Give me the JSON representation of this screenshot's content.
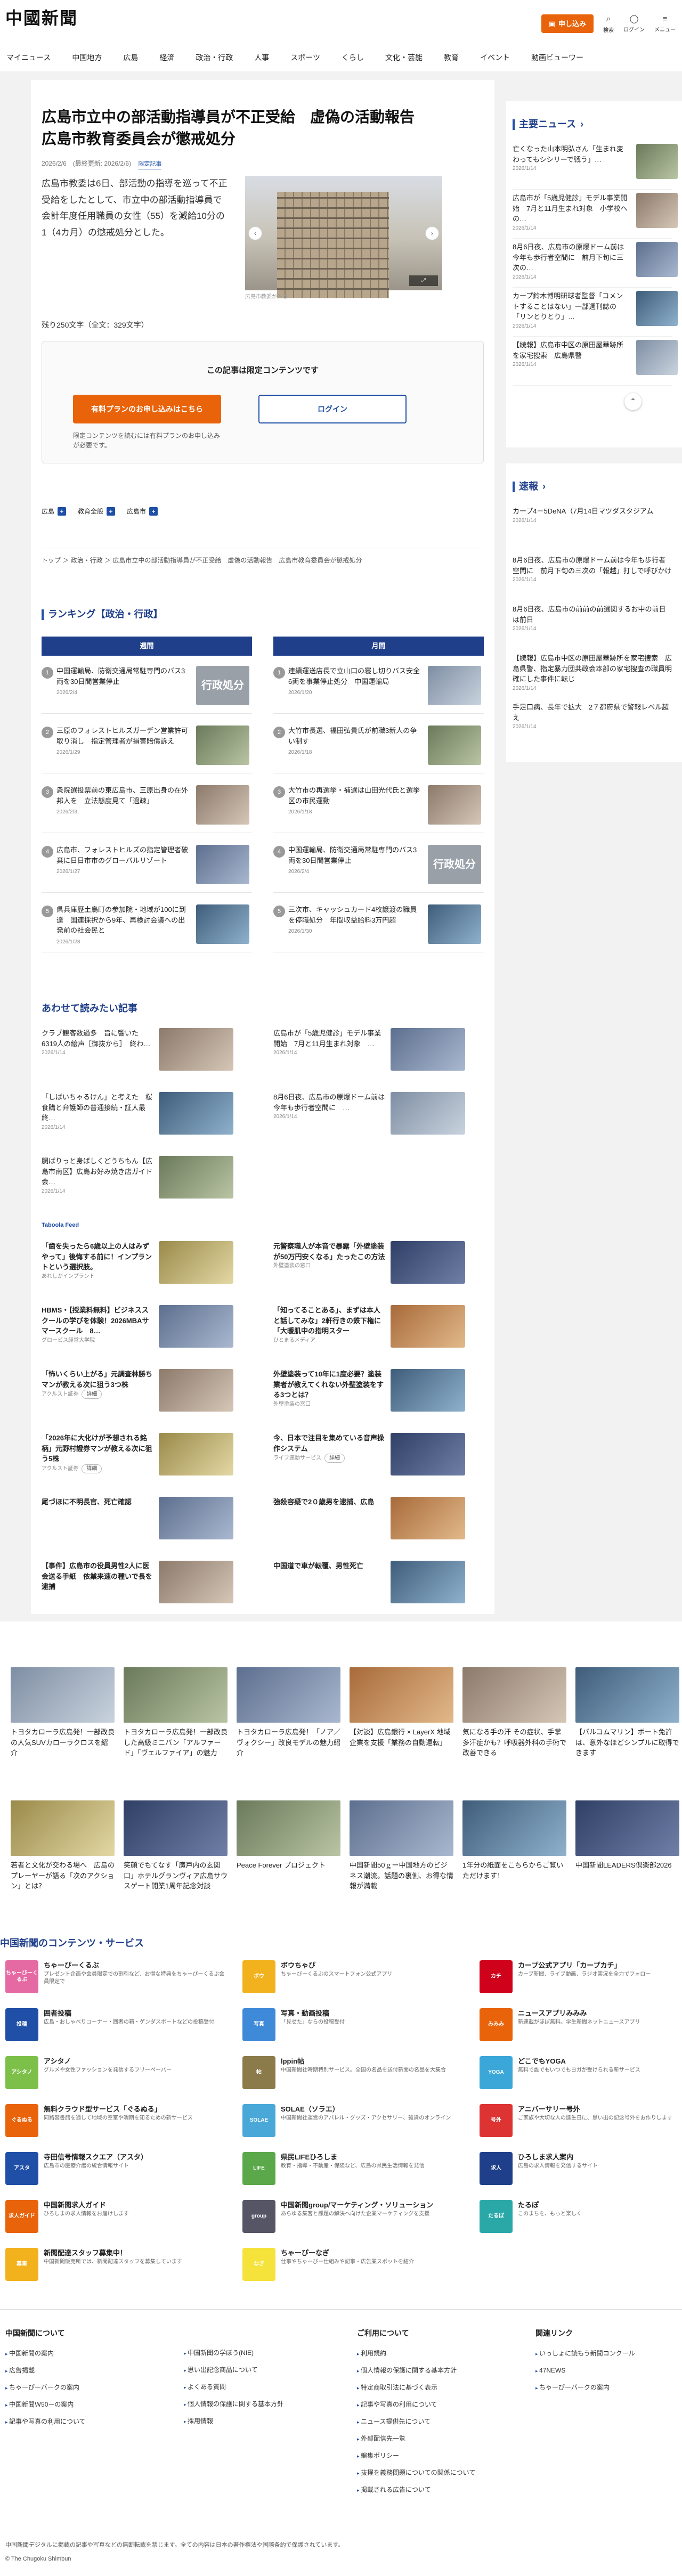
{
  "header": {
    "logo": "中國新聞",
    "apply_btn": "申し込み",
    "search": "検索",
    "login": "ログイン",
    "menu": "メニュー"
  },
  "gnav": [
    "マイニュース",
    "中国地方",
    "広島",
    "経済",
    "政治・行政",
    "人事",
    "スポーツ",
    "くらし",
    "文化・芸能",
    "教育",
    "イベント",
    "動画ビューワー"
  ],
  "article": {
    "title": "広島市立中の部活動指導員が不正受給　虚偽の活動報告　広島市教育委員会が懲戒処分",
    "dates": "2026/2/6　(最終更新: 2026/2/6)",
    "badge": "限定記事",
    "lead": "広島市教委は6日、部活動の指導を巡って不正受給をしたとして、市立中の部活動指導員で会計年度任用職員の女性（55）を減給10分の1（4カ月）の懲戒処分とした。",
    "photo_caption": "広島市教委が入る",
    "char_count": "残り250文字（全文：329文字）",
    "locked_title": "この記事は限定コンテンツです",
    "paid_btn": "有料プランのお申し込みはこちら",
    "login_btn": "ログイン",
    "locked_note": "限定コンテンツを読むには有料プランのお申し込みが必要です。",
    "tags": [
      "広島",
      "教育全般",
      "広島市"
    ],
    "breadcrumb": "トップ ＞ 政治・行政 ＞ 広島市立中の部活動指導員が不正受給　虚偽の活動報告　広島市教育委員会が懲戒処分"
  },
  "ranking": {
    "title": "ランキング【政治・行政】",
    "weekly": "週間",
    "monthly": "月間",
    "left": [
      {
        "n": "1",
        "t": "中国運輸局、防衛交通局常駐専門のバス3両を30日間営業停止",
        "d": "2026/2/4",
        "img": "行政処分"
      },
      {
        "n": "2",
        "t": "三原のフォレストヒルズガーデン営業許可取り消し　指定管理者が損害賠償訴え",
        "d": "2026/1/29",
        "img": ""
      },
      {
        "n": "3",
        "t": "衆院選投票前の東広島市、三原出身の在外邦人を　立法態度見て「過疎」",
        "d": "2026/2/3",
        "img": ""
      },
      {
        "n": "4",
        "t": "広島市、フォレストヒルズの指定管理者破棄に日日市市のグローバルリゾート",
        "d": "2026/1/27",
        "img": ""
      },
      {
        "n": "5",
        "t": "県兵庫歴土鳥町の参加院・地域が100に到達　国連採択から9年、再検討会議への出発前の社会民と",
        "d": "2026/1/28",
        "img": ""
      }
    ],
    "right": [
      {
        "n": "1",
        "t": "連續運送店長で立山口の寝し切りバス安全6両を事業停止処分　中国運輸局",
        "d": "2026/1/20",
        "img": ""
      },
      {
        "n": "2",
        "t": "大竹市長選、福田弘貴氏が前職3新人の争い制す",
        "d": "2026/1/18",
        "img": ""
      },
      {
        "n": "3",
        "t": "大竹市の再選挙・補選は山田光代氏と選挙区の市民運動",
        "d": "2026/1/18",
        "img": ""
      },
      {
        "n": "4",
        "t": "中国運輸局、防衛交通局常駐専門のバス3両を30日間営業停止",
        "d": "2026/2/4",
        "img": "行政処分"
      },
      {
        "n": "5",
        "t": "三次市、キャッシュカード4枚譲渡の職員を停職処分　年間収益給料3万円超",
        "d": "2026/1/30",
        "img": ""
      }
    ]
  },
  "related": {
    "title": "あわせて読みたい記事",
    "items": [
      {
        "t": "クラブ観客数過多　旨に響いた6319人の絵声［御抜から］　終わ…",
        "d": "2026/1/14"
      },
      {
        "t": "広島市が「5歳児健診」モデル事業開始　7月と11月生まれ対象　…",
        "d": "2026/1/14"
      },
      {
        "t": "「しばいちゃるけん」と考えた　桜食購と弁護師の普通接続・証人最終…",
        "d": "2026/1/14"
      },
      {
        "t": "8月6日夜、広島市の原爆ドーム前は今年も歩行者空間に　…",
        "d": "2026/1/14"
      },
      {
        "t": "胴ばりっと身ばしくどうちもん【広島市南区】広島お好み焼き店ガイド　会…",
        "d": "2026/1/14"
      }
    ]
  },
  "ads": {
    "label": "Taboola Feed",
    "items": [
      {
        "t": "「歯を失ったら6歳以上の人はみずやって」後悔する前に！インプラントという選択肢。",
        "s": "あれしかインプラント",
        "btn": ""
      },
      {
        "t": "元警察職人が本音で暴露「外壁塗装が50万円安くなる」たったこの方法",
        "s": "外壁塗装の窓口",
        "btn": ""
      },
      {
        "t": "HBMS・【授業料無料】ビジネススクールの学びを体験！2026MBAサマースクール　8…",
        "s": "グロービス経営大学院",
        "btn": ""
      },
      {
        "t": "「知ってることある」、まずは本人と話してみな」2軒行きの鉄下権に「大暖肌中の指明スター",
        "s": "ひとまるメディア",
        "btn": ""
      },
      {
        "t": "「怖いくらい上がる」元調査林勝ちマンが教える次に狙う3つ株",
        "s": "アクルスト証券",
        "btn": "詳細"
      },
      {
        "t": "外壁塗装って10年に1度必要？塗装業者が教えてくれない外壁塗装をする3つとは？",
        "s": "外壁塗装の窓口",
        "btn": ""
      },
      {
        "t": "「2026年に大化けが予想される銘柄」元野村證券マンが教える次に狙う5株",
        "s": "アクルスト証券",
        "btn": "詳細"
      },
      {
        "t": "今、日本で注目を集めている音声操作システム",
        "s": "ライフ連動サービス",
        "btn": "詳細"
      },
      {
        "t": "尾づほに不明長官、死亡確認",
        "s": "",
        "btn": ""
      },
      {
        "t": "強殺容疑で2０歳男を逮捕、広島",
        "s": "",
        "btn": ""
      },
      {
        "t": "【事件】広島市の役員男性2人に医会送る手紙　依業来速の種いで長を逮捕",
        "s": "",
        "btn": ""
      },
      {
        "t": "中国道で車が転覆、男性死亡",
        "s": "",
        "btn": ""
      }
    ]
  },
  "sidebar": {
    "main_news_title": "主要ニュース",
    "main_news": [
      {
        "t": "亡くなった山本明弘さん「生まれ変わってもシシリーで戦う」…",
        "d": "2026/1/14"
      },
      {
        "t": "広島市が「5歳児健診」モデル事業開始　7月と11月生まれ対象　小学校への…",
        "d": "2026/1/14"
      },
      {
        "t": "8月6日夜、広島市の原爆ドーム前は今年も歩行者空間に　前月下旬に三次の…",
        "d": "2026/1/14"
      },
      {
        "t": "カープ鈴木博明研球者監督「コメントすることはない」一部週刊誌の「リンとりとり」…",
        "d": "2026/1/14"
      },
      {
        "t": "【続報】広島市中区の原田屋華跡所を家宅捜索　広島県警",
        "d": "2026/1/14"
      }
    ],
    "sokuho_title": "速報",
    "sokuho": [
      {
        "t": "カープ4－5DeNA（7月14日マツダスタジアム",
        "d": "2026/1/14"
      },
      {
        "t": "8月6日夜、広島市の原爆ドーム前は今年も歩行者空間に　前月下旬の三次の「報越」打しで呼びかけ",
        "d": "2026/1/14"
      },
      {
        "t": "8月6日夜、広島市の前前の前選関するお中の前日は前日",
        "d": "2026/1/14"
      },
      {
        "t": "【続報】広島市中区の原田屋華跡所を家宅捜索　広島県警、指定暴力団共政会本部の家宅捜査の職員明確にした事件に転じ",
        "d": "2026/1/14"
      },
      {
        "t": "手足口病、長年で拡大　2７都府県で警報レベル超え",
        "d": "2026/1/14"
      }
    ]
  },
  "tiles": [
    {
      "t": "トヨタカローラ広島発！一部改良の人気SUVカローラクロスを紹介"
    },
    {
      "t": "トヨタカローラ広島発！一部改良した高級ミニバン「アルファード」「ヴェルファイア」の魅力"
    },
    {
      "t": "トヨタカローラ広島発！「ノア／ヴォクシー」改良モデルの魅力紹介"
    },
    {
      "t": "【対談】広島銀行 × LayerX 地域企業を支援「業務の自動運転」"
    },
    {
      "t": "気になる手の汗 その症状、手掌多汗症かも？呼吸器外科の手術で改善できる"
    },
    {
      "t": "【バルコムマリン】ボート免許は、意外なほどシンプルに取得できます"
    },
    {
      "t": "若者と文化が交わる場へ　広島のプレーヤーが語る「次のアクション」とは？"
    },
    {
      "t": "笑顔でもてなす「廣戸内の玄関口」ホテルグランヴィア広島サウスゲート開業1周年記念対談"
    },
    {
      "t": "Peace Forever プロジェクト"
    },
    {
      "t": "中国新聞50ｇー中国地方のビジネス潮流。話題の裏側、お得な情報が満載"
    },
    {
      "t": "1年分の紙面をこちらからご覧いただけます！"
    },
    {
      "t": "中国新聞LEADERS倶楽部2026"
    }
  ],
  "services": {
    "title": "中国新聞のコンテンツ・サービス",
    "items": [
      {
        "n": "ちゃーぴーくるぶ",
        "d": "プレゼント企画や会員限定での割引など、お得な特典をちゃーぴーくるぶ会員限定で",
        "c": "#e56aa4",
        "l": "ちゃーぴーくるぶ"
      },
      {
        "n": "ボウちゃぴ",
        "d": "ちゃーぴーくるぶのスマートフォン公式アプリ",
        "c": "#f2b21d",
        "l": "ボウ"
      },
      {
        "n": "カープ公式アプリ「カープカチ」",
        "d": "カープ新聞、ライブ動画、ラジオ実況を全力でフォロー",
        "c": "#d0021b",
        "l": "カチ"
      },
      {
        "n": "囲者投稿",
        "d": "広島・おしゃべりコーナー・囲者の箱・ゲンダスポートなどの投稿受付",
        "c": "#1f4fa6",
        "l": "投稿"
      },
      {
        "n": "写真・動画投稿",
        "d": "「見せた」ならの投稿受付",
        "c": "#3f8ad8",
        "l": "写真"
      },
      {
        "n": "ニュースアプリみみみ",
        "d": "新連載がほぼ無料。学生新聞ネットニュースアプリ",
        "c": "#e8630a",
        "l": "みみみ"
      },
      {
        "n": "アシタノ",
        "d": "グルメや女性ファッションを発信するフリーペーパー",
        "c": "#7cc04a",
        "l": "アシタノ"
      },
      {
        "n": "lppin帖",
        "d": "中国新聞社時期特別サービス。全国の名品を送付新聞の名品を大集合",
        "c": "#8b7a4a",
        "l": "帖"
      },
      {
        "n": "どこでもYOGA",
        "d": "無料で誰でもいつでもヨガが受けられる新サービス",
        "c": "#3aa7d8",
        "l": "YOGA"
      },
      {
        "n": "無料クラウド型サービス「ぐるぬる」",
        "d": "同路図書館を通して地域の空室や暇期を知るための新サービス",
        "c": "#e8630a",
        "l": "ぐるぬる"
      },
      {
        "n": "SOLAE（ソラエ）",
        "d": "中国新聞社運営のアパレル・グッズ・アクセサリー、雑貨のオンライン",
        "c": "#4aa8d8",
        "l": "SOLAE"
      },
      {
        "n": "アニバーサリー号外",
        "d": "ご家族や大切な人の誕生日に、思い出の記念号外をお作りします",
        "c": "#d33",
        "l": "号外"
      },
      {
        "n": "寺田信号情報スクエア（アスタ）",
        "d": "広島市の医療介護の統合情報サイト",
        "c": "#1f4fa6",
        "l": "アスタ"
      },
      {
        "n": "県民LIFEひろしま",
        "d": "教育・指導・不動産・保険など、広島の県民生活情報を発信",
        "c": "#5aa84a",
        "l": "LIFE"
      },
      {
        "n": "ひろしま求人案内",
        "d": "広島の求人情報を発信するサイト",
        "c": "#1f3f8a",
        "l": "求人"
      },
      {
        "n": "中国新聞求人ガイド",
        "d": "ひろしまの求人情報をお届けします",
        "c": "#e8630a",
        "l": "求人ガイド"
      },
      {
        "n": "中国新聞group/マーケティング・ソリューション",
        "d": "あらゆる集客と課題の解決へ向けた企業マーケティングを支援",
        "c": "#556",
        "l": "group"
      },
      {
        "n": "たるぽ",
        "d": "このまちを、もっと楽しく",
        "c": "#2aa8a8",
        "l": "たるぽ"
      },
      {
        "n": "新聞配達スタッフ募集中！",
        "d": "中国新聞販売所では、新聞配達スタッフを募集しています",
        "c": "#f2b21d",
        "l": "募集"
      },
      {
        "n": "ちゃーぴーなぎ",
        "d": "仕事やちゃーぴー仕組みや記事・広告業スポットを紹介",
        "c": "#f5e23a",
        "l": "なぎ"
      }
    ]
  },
  "footer": {
    "col1_title": "中国新聞について",
    "col1": [
      "中国新聞の案内",
      "広告掲載",
      "ちゃーぴーバークの案内",
      "中国新聞Ｗ50ーの案内",
      "記事や写真の利用について"
    ],
    "col1b": [
      "中国新聞の学ぼう(NIE)",
      "思い出記念商品について",
      "よくある質問",
      "個人情報の保護に関する基本方針",
      "採用情報"
    ],
    "col2_title": "ご利用について",
    "col2": [
      "利用規約",
      "個人情報の保護に関する基本方針",
      "特定商取引法に基づく表示",
      "記事や写真の利用について",
      "ニュース提供先について",
      "外部配信先一覧",
      "編集ポリシー",
      "抜擢を義務問題についての関係について",
      "掲載される広告について"
    ],
    "col3_title": "関連リンク",
    "col3": [
      "いっしょに読もう新聞コンクール",
      "47NEWS",
      "ちゃーぴーバークの案内"
    ],
    "copyright_note": "中国新聞デジタルに掲載の記事や写真などの無断転載を禁じます。全ての内容は日本の著作権法や国際条約で保護されています。",
    "copyright": "© The Chugoku Shimbun"
  }
}
